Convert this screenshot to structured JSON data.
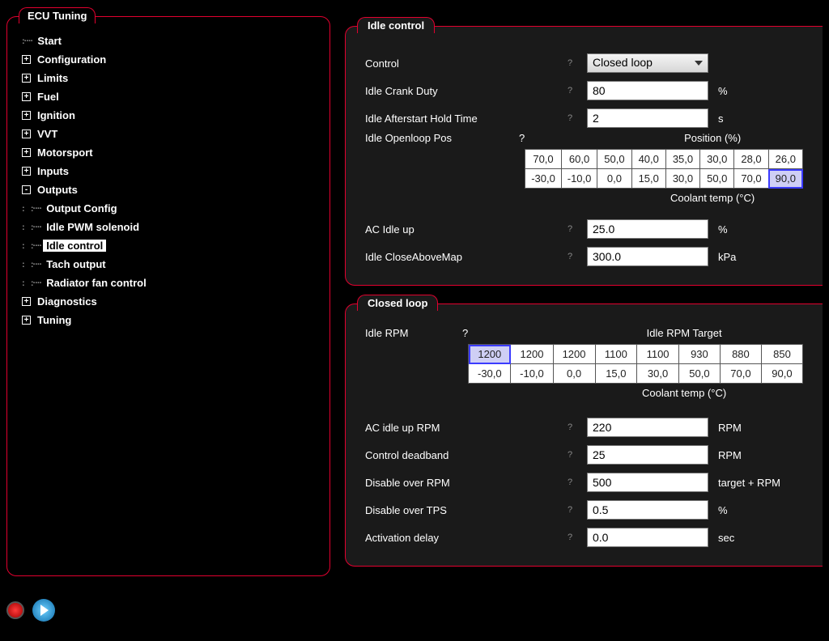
{
  "tree_title": "ECU Tuning",
  "tree": {
    "start": "Start",
    "configuration": "Configuration",
    "limits": "Limits",
    "fuel": "Fuel",
    "ignition": "Ignition",
    "vvt": "VVT",
    "motorsport": "Motorsport",
    "inputs": "Inputs",
    "outputs": "Outputs",
    "outputs_children": {
      "output_config": "Output Config",
      "idle_pwm": "Idle PWM solenoid",
      "idle_control": "Idle control",
      "tach_output": "Tach output",
      "radiator_fan": "Radiator fan control"
    },
    "diagnostics": "Diagnostics",
    "tuning": "Tuning"
  },
  "idle_group": {
    "title": "Idle control",
    "control_label": "Control",
    "control_value": "Closed loop",
    "crank_label": "Idle Crank Duty",
    "crank_value": "80",
    "crank_unit": "%",
    "afterstart_label": "Idle Afterstart Hold Time",
    "afterstart_value": "2",
    "afterstart_unit": "s",
    "openloop_label": "Idle Openloop Pos",
    "openloop_title": "Position (%)",
    "openloop_row1": [
      "70,0",
      "60,0",
      "50,0",
      "40,0",
      "35,0",
      "30,0",
      "28,0",
      "26,0"
    ],
    "openloop_row2": [
      "-30,0",
      "-10,0",
      "0,0",
      "15,0",
      "30,0",
      "50,0",
      "70,0",
      "90,0"
    ],
    "openloop_axis": "Coolant temp (°C)",
    "ac_label": "AC Idle up",
    "ac_value": "25.0",
    "ac_unit": "%",
    "closeabove_label": "Idle CloseAboveMap",
    "closeabove_value": "300.0",
    "closeabove_unit": "kPa"
  },
  "closed_group": {
    "title": "Closed loop",
    "rpm_label": "Idle RPM",
    "rpm_title": "Idle RPM Target",
    "rpm_row1": [
      "1200",
      "1200",
      "1200",
      "1100",
      "1100",
      "930",
      "880",
      "850"
    ],
    "rpm_row2": [
      "-30,0",
      "-10,0",
      "0,0",
      "15,0",
      "30,0",
      "50,0",
      "70,0",
      "90,0"
    ],
    "rpm_axis": "Coolant temp (°C)",
    "ac_rpm_label": "AC idle up RPM",
    "ac_rpm_value": "220",
    "ac_rpm_unit": "RPM",
    "deadband_label": "Control deadband",
    "deadband_value": "25",
    "deadband_unit": "RPM",
    "disable_rpm_label": "Disable over RPM",
    "disable_rpm_value": "500",
    "disable_rpm_unit": "target + RPM",
    "disable_tps_label": "Disable over TPS",
    "disable_tps_value": "0.5",
    "disable_tps_unit": "%",
    "act_delay_label": "Activation delay",
    "act_delay_value": "0.0",
    "act_delay_unit": "sec"
  },
  "help_marker": "?",
  "plus_marker": "+",
  "minus_marker": "-",
  "chart_data": [
    {
      "type": "table",
      "title": "Idle Openloop Pos — Position (%)",
      "xlabel": "Coolant temp (°C)",
      "ylabel": "Position (%)",
      "x": [
        -30.0,
        -10.0,
        0.0,
        15.0,
        30.0,
        50.0,
        70.0,
        90.0
      ],
      "values": [
        70.0,
        60.0,
        50.0,
        40.0,
        35.0,
        30.0,
        28.0,
        26.0
      ]
    },
    {
      "type": "table",
      "title": "Idle RPM Target",
      "xlabel": "Coolant temp (°C)",
      "ylabel": "Idle RPM",
      "x": [
        -30.0,
        -10.0,
        0.0,
        15.0,
        30.0,
        50.0,
        70.0,
        90.0
      ],
      "values": [
        1200,
        1200,
        1200,
        1100,
        1100,
        930,
        880,
        850
      ]
    }
  ]
}
